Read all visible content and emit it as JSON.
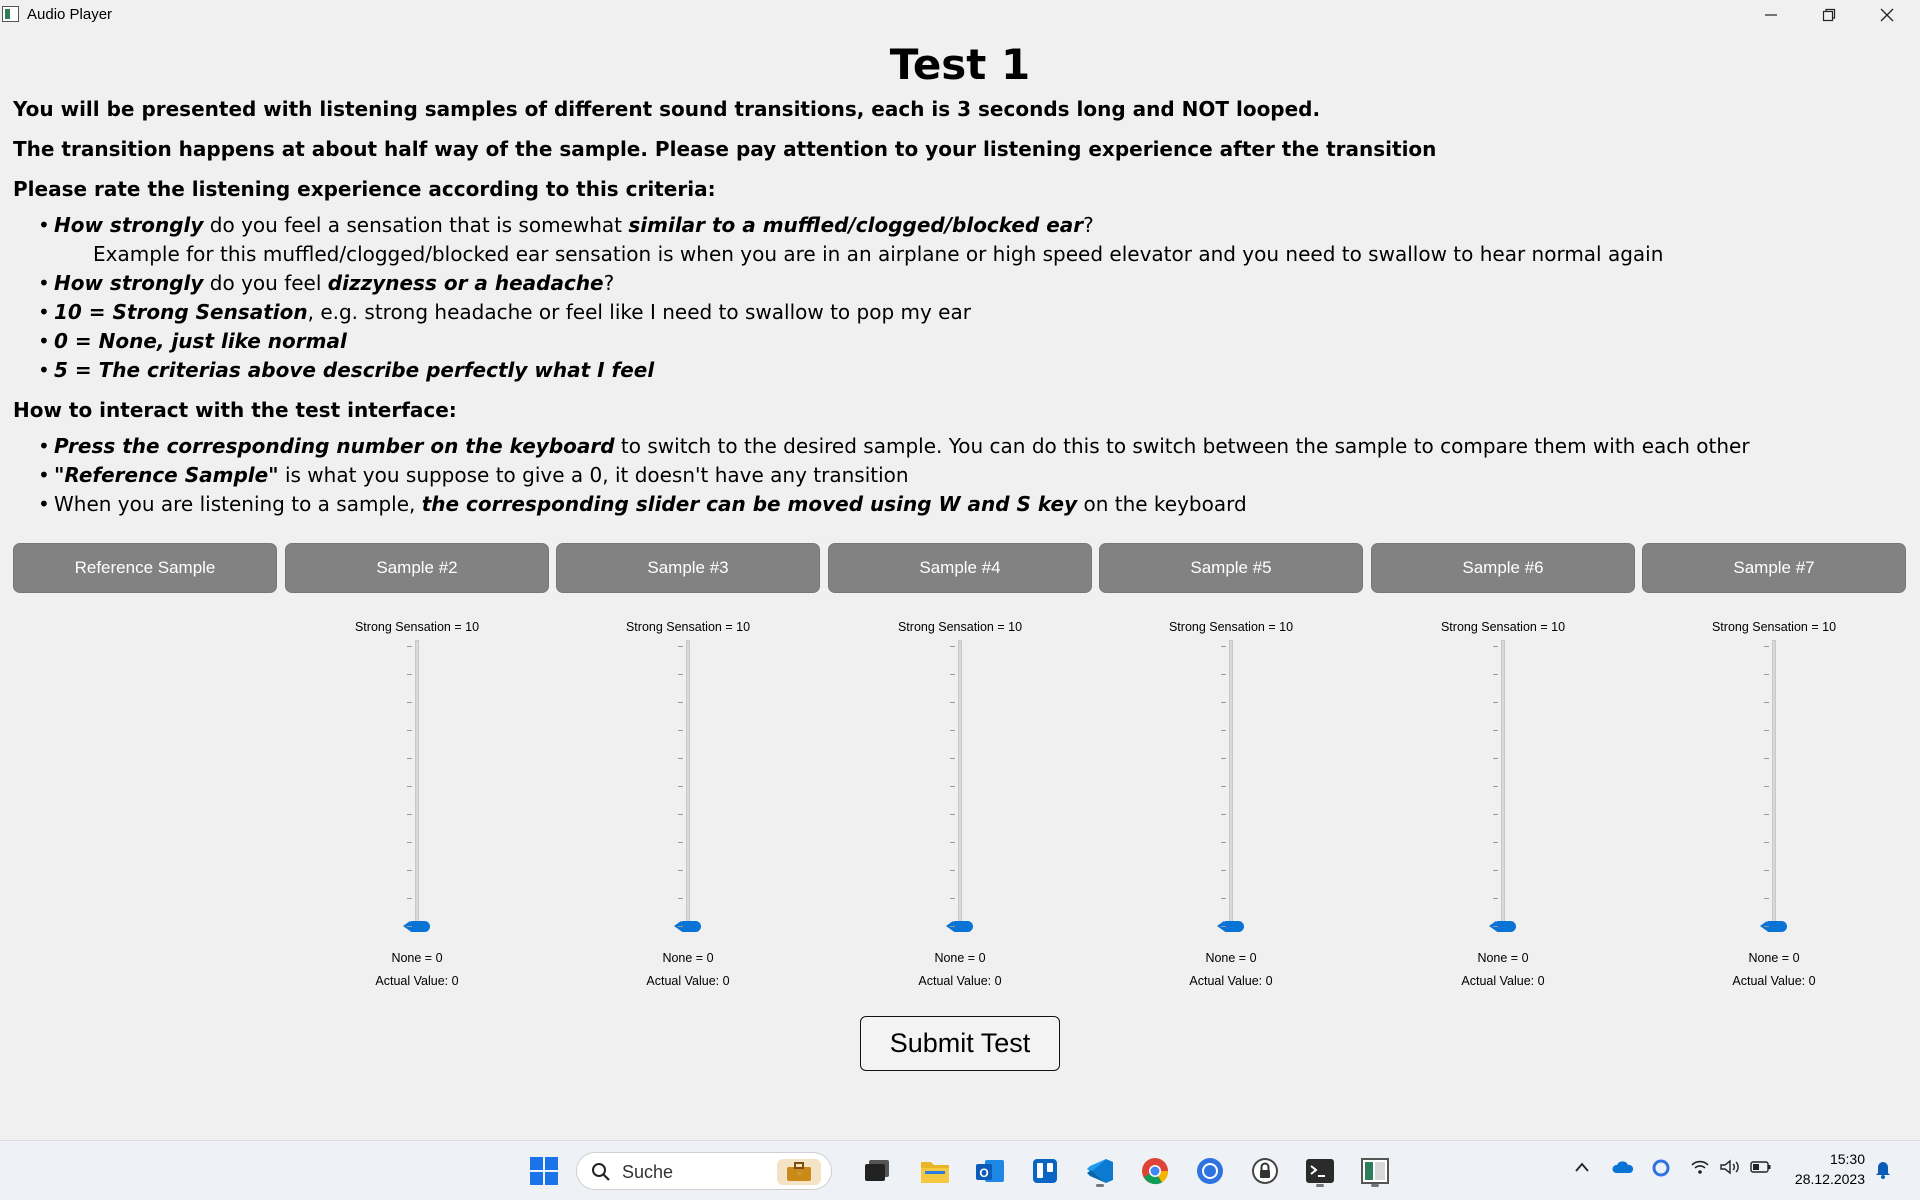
{
  "window": {
    "title": "Audio Player"
  },
  "heading": "Test 1",
  "intro": {
    "line1": "You will be presented with listening samples of different sound transitions, each is 3 seconds long and NOT looped.",
    "line2": "The transition happens at about half way of the sample. Please pay attention to your listening experience after the transition",
    "criteria_title": "Please rate the listening experience according to this criteria:"
  },
  "criteria": {
    "b1_a": "How strongly",
    "b1_b": " do you feel a sensation that is somewhat ",
    "b1_c": "similar to a muffled/clogged/blocked ear",
    "b1_d": "?",
    "example": "Example for this muffled/clogged/blocked ear sensation is when you are in an airplane or high speed elevator and you need to swallow to hear normal again",
    "b2_a": "How strongly",
    "b2_b": " do you feel ",
    "b2_c": "dizzyness or a headache",
    "b2_d": "?",
    "b3_a": "10 = Strong Sensation",
    "b3_b": ", e.g. strong headache or feel like I need to swallow to pop my ear",
    "b4": "0 = None, just like normal",
    "b5": "5 = The criterias above describe perfectly what I feel"
  },
  "interaction": {
    "title": "How to interact with the test interface:",
    "b1_a": "Press the corresponding number on the keyboard",
    "b1_b": " to switch to the desired sample. You can do this to switch between the sample to compare them with each other",
    "b2_a": "\"Reference Sample\"",
    "b2_b": " is what you suppose to give a 0, it doesn't have any transition",
    "b3_a": "When you are listening to a sample, ",
    "b3_b": "the corresponding slider can be moved using W and S key",
    "b3_c": " on the keyboard"
  },
  "samples": [
    {
      "label": "Reference Sample"
    },
    {
      "label": "Sample #2"
    },
    {
      "label": "Sample #3"
    },
    {
      "label": "Sample #4"
    },
    {
      "label": "Sample #5"
    },
    {
      "label": "Sample #6"
    },
    {
      "label": "Sample #7"
    }
  ],
  "sliders": [
    {
      "top_label": "Strong Sensation = 10",
      "bottom_label": "None = 0",
      "actual": "Actual Value: 0",
      "value": 0,
      "max": 10
    },
    {
      "top_label": "Strong Sensation = 10",
      "bottom_label": "None = 0",
      "actual": "Actual Value: 0",
      "value": 0,
      "max": 10
    },
    {
      "top_label": "Strong Sensation = 10",
      "bottom_label": "None = 0",
      "actual": "Actual Value: 0",
      "value": 0,
      "max": 10
    },
    {
      "top_label": "Strong Sensation = 10",
      "bottom_label": "None = 0",
      "actual": "Actual Value: 0",
      "value": 0,
      "max": 10
    },
    {
      "top_label": "Strong Sensation = 10",
      "bottom_label": "None = 0",
      "actual": "Actual Value: 0",
      "value": 0,
      "max": 10
    },
    {
      "top_label": "Strong Sensation = 10",
      "bottom_label": "None = 0",
      "actual": "Actual Value: 0",
      "value": 0,
      "max": 10
    }
  ],
  "submit_label": "Submit Test",
  "taskbar": {
    "search_placeholder": "Suche",
    "time": "15:30",
    "date": "28.12.2023",
    "apps": [
      "windows-start-icon",
      "briefcase-icon",
      "task-view-icon",
      "file-explorer-icon",
      "outlook-icon",
      "trello-icon",
      "vscode-icon",
      "chrome-icon",
      "circle-app-icon",
      "lock-app-icon",
      "terminal-icon",
      "audio-player-app-icon"
    ]
  },
  "colors": {
    "button_bg": "#828282",
    "slider_handle": "#0a73d6",
    "background": "#f0f0f0"
  }
}
